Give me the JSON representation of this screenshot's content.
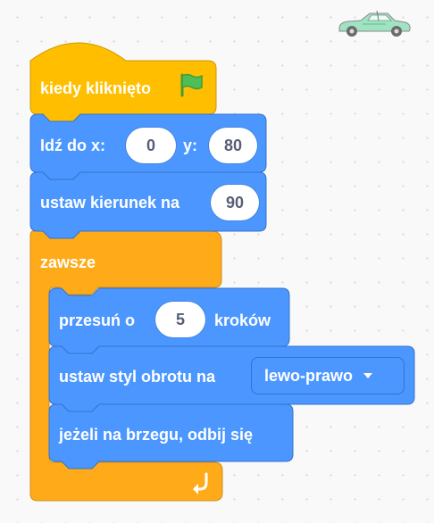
{
  "script": {
    "hat": {
      "label": "kiedy kliknięto",
      "icon": "green-flag-icon"
    },
    "goto": {
      "label": "Idź do x:",
      "x_value": "0",
      "y_label": "y:",
      "y_value": "80"
    },
    "direction": {
      "label": "ustaw kierunek na",
      "value": "90"
    },
    "forever": {
      "label": "zawsze",
      "icon": "loop-arrow-icon"
    },
    "move": {
      "label_before": "przesuń o",
      "value": "5",
      "label_after": "kroków"
    },
    "rotation": {
      "label": "ustaw styl obrotu na",
      "selected": "lewo-prawo"
    },
    "bounce": {
      "label": "jeżeli na brzegu, odbij się"
    }
  },
  "sprite": {
    "icon": "car-sprite-icon"
  },
  "colors": {
    "events": "#ffbf00",
    "motion": "#4c97ff",
    "control": "#ffab19",
    "workspace": "#f9f9f9"
  }
}
